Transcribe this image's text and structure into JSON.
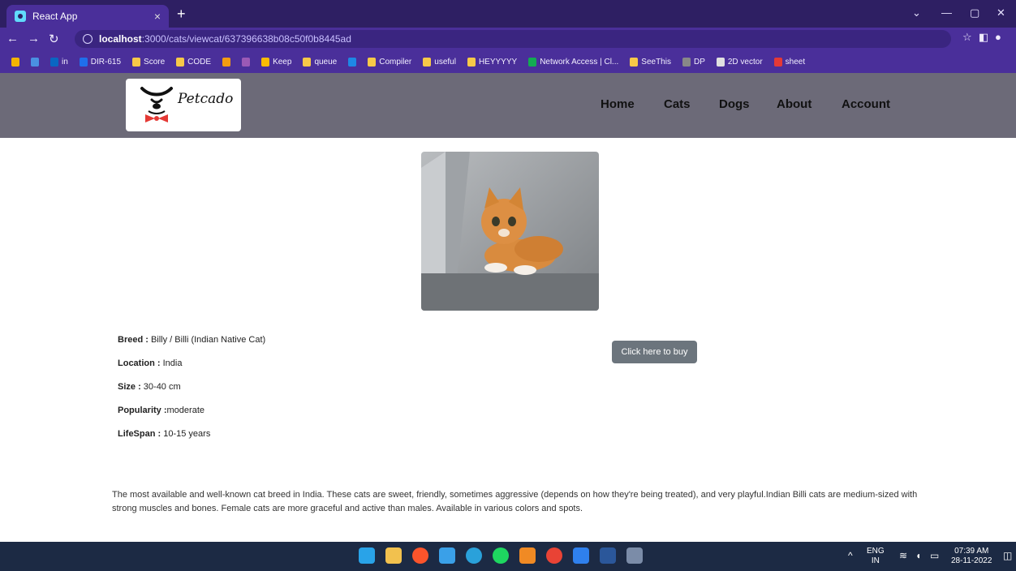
{
  "browser": {
    "tab_title": "React App",
    "tab_close": "×",
    "new_tab": "+",
    "url_host": "localhost",
    "url_path": ":3000/cats/viewcat/637396638b08c50f0b8445ad",
    "bookmarks": [
      {
        "label": "",
        "color": "#f4b400"
      },
      {
        "label": "",
        "color": "#4a90e2"
      },
      {
        "label": "in",
        "color": "#0a66c2"
      },
      {
        "label": "DIR-615",
        "color": "#1f6feb"
      },
      {
        "label": "Score",
        "color": "#f7c948"
      },
      {
        "label": "CODE",
        "color": "#f7c948"
      },
      {
        "label": "",
        "color": "#f39c12"
      },
      {
        "label": "",
        "color": "#9b59b6"
      },
      {
        "label": "Keep",
        "color": "#fbbc04"
      },
      {
        "label": "queue",
        "color": "#f7c948"
      },
      {
        "label": "",
        "color": "#1e88e5"
      },
      {
        "label": "Compiler",
        "color": "#f7c948"
      },
      {
        "label": "useful",
        "color": "#f7c948"
      },
      {
        "label": "HEYYYYY",
        "color": "#f7c948"
      },
      {
        "label": "Network Access | Cl...",
        "color": "#13aa52"
      },
      {
        "label": "SeeThis",
        "color": "#f7c948"
      },
      {
        "label": "DP",
        "color": "#888888"
      },
      {
        "label": "2D vector",
        "color": "#e0e0e0"
      },
      {
        "label": "sheet",
        "color": "#e53935"
      }
    ]
  },
  "site": {
    "logo_text": "Petcado",
    "nav": [
      "Home",
      "Cats",
      "Dogs",
      "About",
      "Account"
    ],
    "details": [
      {
        "label": "Breed :",
        "value": " Billy / Billi (Indian Native Cat)"
      },
      {
        "label": "Location :",
        "value": " India"
      },
      {
        "label": "Size :",
        "value": " 30-40 cm"
      },
      {
        "label": "Popularity :",
        "value": "moderate"
      },
      {
        "label": "LifeSpan :",
        "value": " 10-15 years"
      }
    ],
    "buy_label": "Click here to buy",
    "description": "The most available and well-known cat breed in India. These cats are sweet, friendly, sometimes aggressive (depends on how they're being treated), and very playful.Indian Billi cats are medium-sized with strong muscles and bones. Female cats are more graceful and active than males. Available in various colors and spots."
  },
  "taskbar": {
    "lang_top": "ENG",
    "lang_bottom": "IN",
    "time": "07:39 AM",
    "date": "28-11-2022"
  },
  "colors": {
    "header_bg": "#6c6a78",
    "button_bg": "#6c757d",
    "chrome_accent": "#4a2f9a"
  }
}
